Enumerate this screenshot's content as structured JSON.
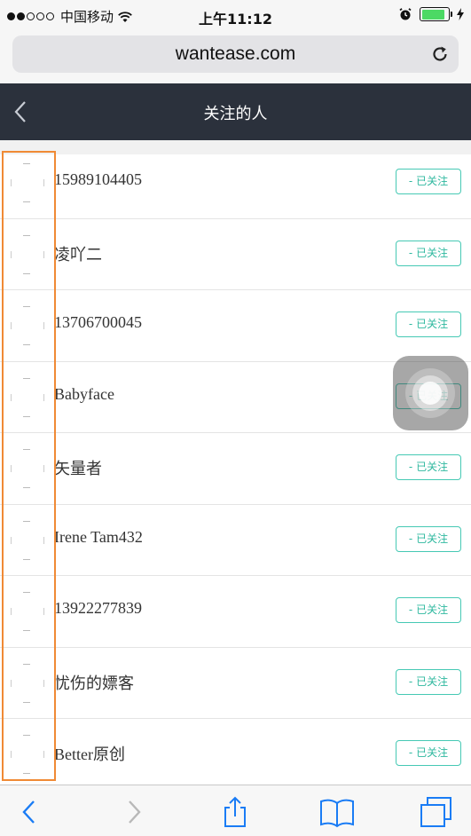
{
  "status_bar": {
    "carrier": "中国移动",
    "time": "上午11:12",
    "signal_icon": "signal-dots-icon",
    "wifi_icon": "wifi-icon",
    "alarm_icon": "alarm-icon",
    "battery_icon": "battery-icon",
    "charging_icon": "charging-bolt-icon",
    "battery_level": 0.88
  },
  "browser": {
    "url": "wantease.com",
    "reload_icon": "reload-icon"
  },
  "header": {
    "title": "关注的人",
    "back_icon": "chevron-left-icon",
    "background": "#2b313c"
  },
  "follow_list": [
    {
      "name": "15989104405",
      "button": "- 已关注"
    },
    {
      "name": "凌吖二",
      "button": "- 已关注"
    },
    {
      "name": "13706700045",
      "button": "- 已关注"
    },
    {
      "name": "Babyface",
      "button": "- 已关注"
    },
    {
      "name": "矢量者",
      "button": "- 已关注"
    },
    {
      "name": "Irene Tam432",
      "button": "- 已关注"
    },
    {
      "name": "13922277839",
      "button": "- 已关注"
    },
    {
      "name": "忧伤的嫖客",
      "button": "- 已关注"
    },
    {
      "name": "Better原创",
      "button": "- 已关注"
    }
  ],
  "colors": {
    "accent": "#46c9b4",
    "highlight": "#f08a35",
    "ios_blue": "#1a7cf5"
  },
  "toolbar": {
    "back_icon": "chevron-left-icon",
    "forward_icon": "chevron-right-icon",
    "share_icon": "share-icon",
    "bookmarks_icon": "book-icon",
    "tabs_icon": "tabs-icon"
  }
}
